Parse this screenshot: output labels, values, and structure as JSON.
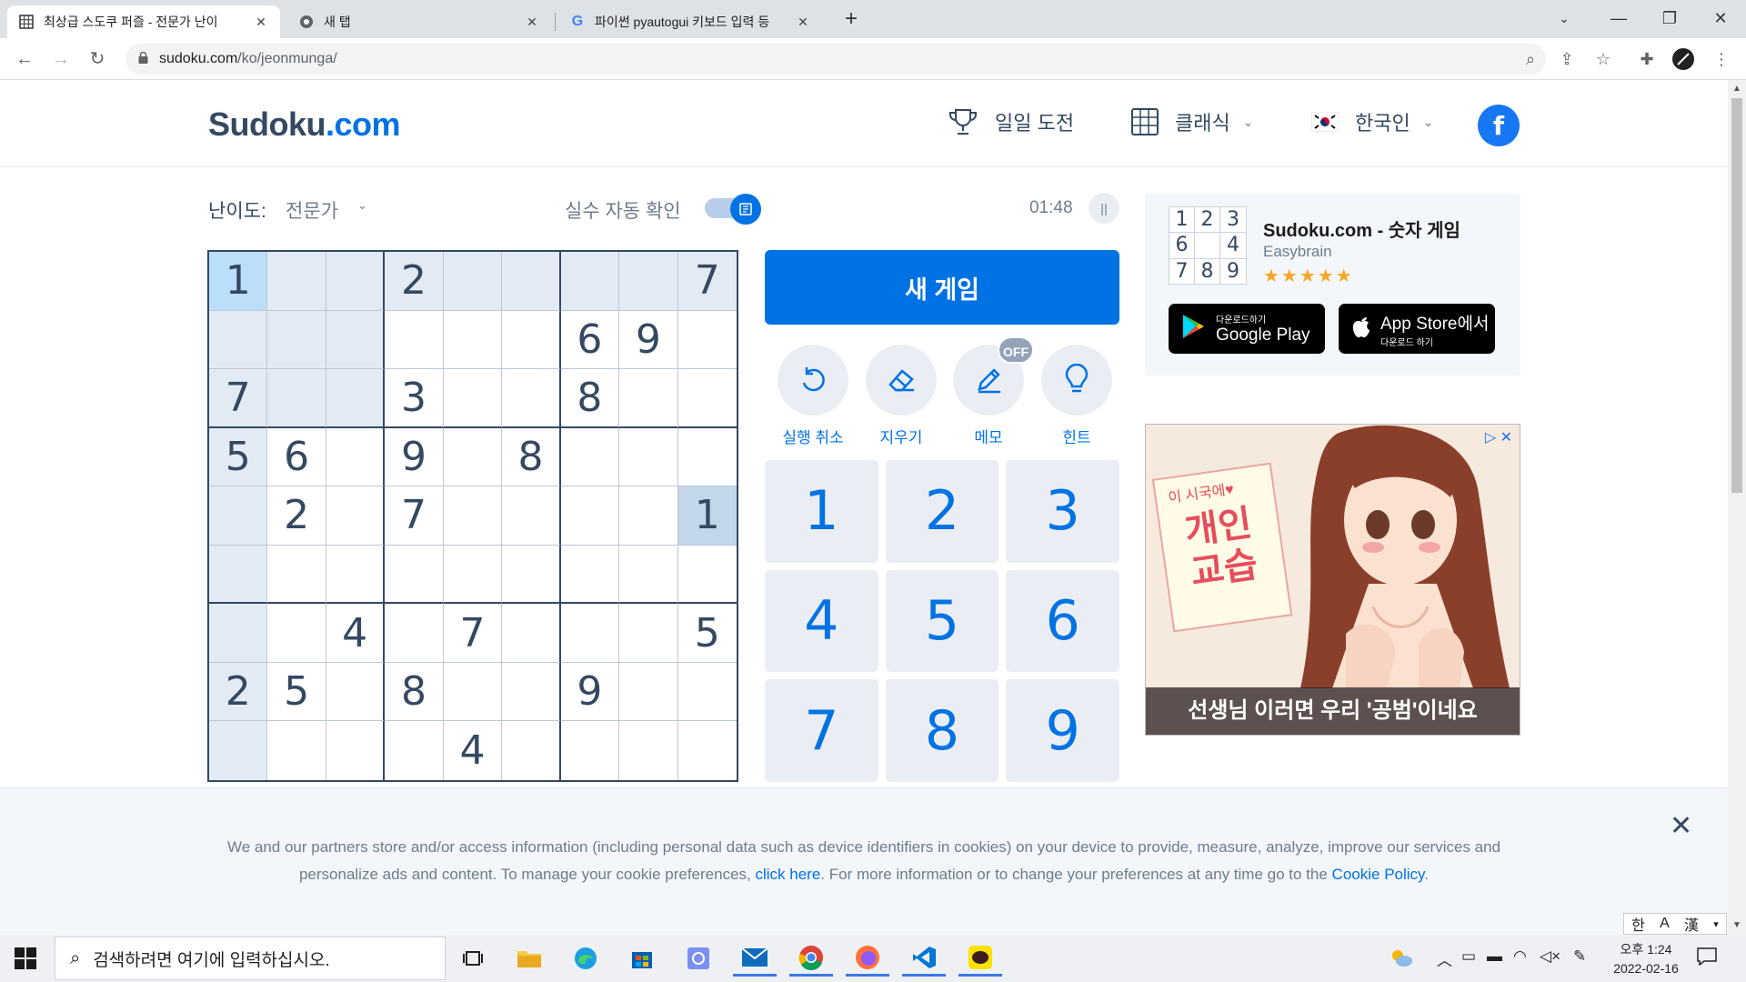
{
  "browser": {
    "tabs": [
      {
        "title": "최상급 스도쿠 퍼즐 - 전문가 난이",
        "active": true
      },
      {
        "title": "새 탭",
        "active": false
      },
      {
        "title": "파이썬 pyautogui 키보드 입력 등",
        "active": false
      }
    ],
    "url_host": "sudoku.com",
    "url_path": "/ko/jeonmunga/"
  },
  "header": {
    "logo_main": "Sudoku",
    "logo_dot": ".com",
    "nav_daily": "일일 도전",
    "nav_classic": "클래식",
    "nav_language": "한국인",
    "facebook": "f"
  },
  "game": {
    "difficulty_label": "난이도:",
    "difficulty_value": "전문가",
    "autocheck_label": "실수 자동 확인",
    "timer": "01:48",
    "pause_icon": "||",
    "grid": [
      [
        "1",
        "",
        "",
        "2",
        "",
        "",
        "",
        "",
        "7"
      ],
      [
        "",
        "",
        "",
        "",
        "",
        "",
        "6",
        "9",
        ""
      ],
      [
        "7",
        "",
        "",
        "3",
        "",
        "",
        "8",
        "",
        ""
      ],
      [
        "5",
        "6",
        "",
        "9",
        "",
        "8",
        "",
        "",
        ""
      ],
      [
        "",
        "2",
        "",
        "7",
        "",
        "",
        "",
        "",
        "1"
      ],
      [
        "",
        "",
        "",
        "",
        "",
        "",
        "",
        "",
        ""
      ],
      [
        "",
        "",
        "4",
        "",
        "7",
        "",
        "",
        "",
        "5"
      ],
      [
        "2",
        "5",
        "",
        "8",
        "",
        "",
        "9",
        "",
        ""
      ],
      [
        "",
        "",
        "",
        "",
        "4",
        "",
        "",
        "",
        ""
      ]
    ],
    "selected_cell": [
      0,
      0
    ],
    "new_game": "새 게임",
    "tools": {
      "undo": "실행 취소",
      "erase": "지우기",
      "notes": "메모",
      "notes_state": "OFF",
      "hint": "힌트"
    },
    "numpad": [
      "1",
      "2",
      "3",
      "4",
      "5",
      "6",
      "7",
      "8",
      "9"
    ]
  },
  "promo": {
    "icon_digits": [
      "1",
      "2",
      "3",
      "6",
      "",
      "4",
      "7",
      "8",
      "9"
    ],
    "title": "Sudoku.com - 숫자 게임",
    "developer": "Easybrain",
    "rating_stars": "★★★★★",
    "google_small": "다운로드하기",
    "google_big": "Google Play",
    "apple_big": "App Store에서",
    "apple_small": "다운로드 하기"
  },
  "ad": {
    "sign_small": "이 시국에♥",
    "sign_big": "개인 교습",
    "caption": "선생님 이러면 우리 '공범'이네요",
    "close": "✕"
  },
  "cookie": {
    "text_before": "We and our partners store and/or access information (including personal data such as device identifiers in cookies) on your device to provide, measure, analyze, improve our services and personalize ads and content. To manage your cookie preferences,",
    "link_click": "click here",
    "text_middle": ". For more information or to change your preferences at any time go to the",
    "link_policy": "Cookie Policy",
    "text_after": "."
  },
  "ime": {
    "han": "한",
    "a": "A"
  },
  "taskbar": {
    "search_placeholder": "검색하려면 여기에 입력하십시오.",
    "time": "오후 1:24",
    "date": "2022-02-16"
  },
  "colors": {
    "accent": "#0072e3",
    "text_dark": "#344861",
    "text_muted": "#6e7c8c",
    "cell_highlight": "#e2ebf3",
    "cell_selected": "#bbdefb",
    "cell_same_number": "#c3d7ea"
  }
}
